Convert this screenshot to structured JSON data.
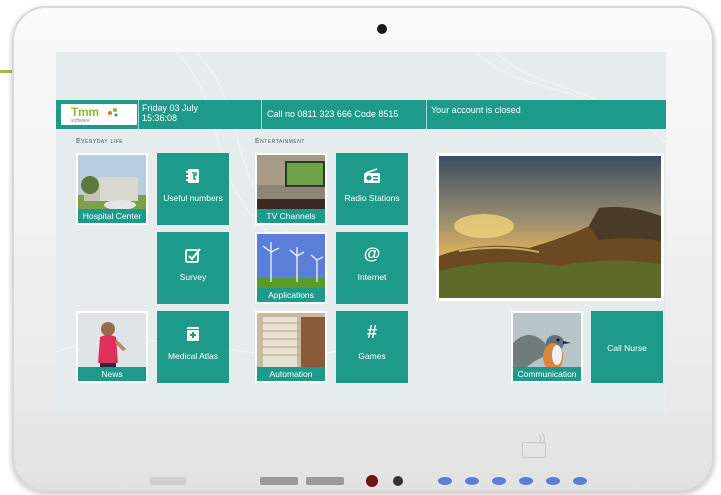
{
  "header": {
    "logo_text": "Tmm",
    "logo_sub": "software",
    "date_line1": "Friday 03 July",
    "date_line2": "15:36:08",
    "call_info": "Call no 0811 323 666 Code 8515",
    "account_status": "Your account is closed"
  },
  "sections": {
    "everyday": "Everyday life",
    "entertainment": "Entertainment"
  },
  "tiles": {
    "hospital_center": "Hospital Center",
    "useful_numbers": "Useful numbers",
    "survey": "Survey",
    "news": "News",
    "medical_atlas": "Medical Atlas",
    "tv_channels": "TV Channels",
    "radio_stations": "Radio Stations",
    "applications": "Applications",
    "internet": "Internet",
    "automation": "Automation",
    "games": "Games",
    "communication": "Communication",
    "call_nurse": "Call Nurse"
  },
  "colors": {
    "accent": "#1e9a8b",
    "logo_green": "#8cbc2a"
  },
  "icons": [
    "phonebook-icon",
    "checkbox-icon",
    "medical-book-icon",
    "radio-icon",
    "at-icon",
    "hash-icon",
    "camera-icon",
    "nfc-icon"
  ]
}
